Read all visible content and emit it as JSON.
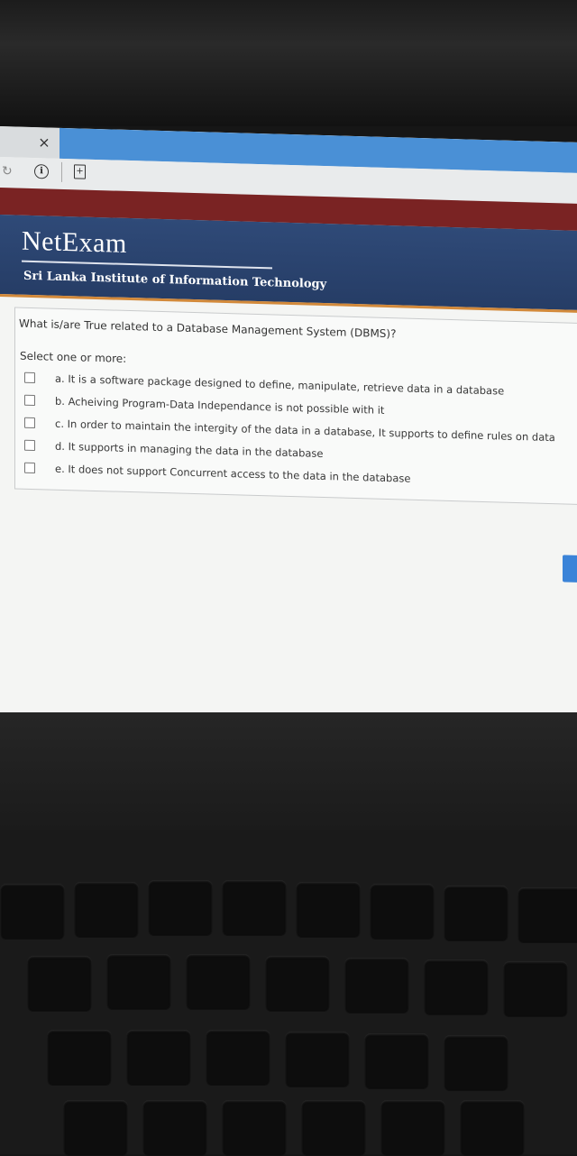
{
  "browser": {
    "tab_close_glyph": "×",
    "info_glyph": "i",
    "page_glyph": "+"
  },
  "header": {
    "brand": "NetExam",
    "institute": "Sri Lanka Institute of Information Technology"
  },
  "question": {
    "text": "What is/are True related to a Database Management System (DBMS)?",
    "prompt": "Select one or more:",
    "options": [
      {
        "label": "a. It is a software package designed to define, manipulate, retrieve data in a database",
        "checked": false
      },
      {
        "label": "b. Acheiving Program-Data Independance is not possible with it",
        "checked": false
      },
      {
        "label": "c. In order to maintain the intergity of the data in a database, It supports to define rules on data",
        "checked": false
      },
      {
        "label": "d. It supports in managing the data in the database",
        "checked": false
      },
      {
        "label": "e. It does not support Concurrent access to the data in the database",
        "checked": false
      }
    ]
  },
  "colors": {
    "header_bg": "#2f4a78",
    "header_accent": "#d2893a",
    "top_band": "#7a2323",
    "active_tab": "#4a90d6"
  }
}
